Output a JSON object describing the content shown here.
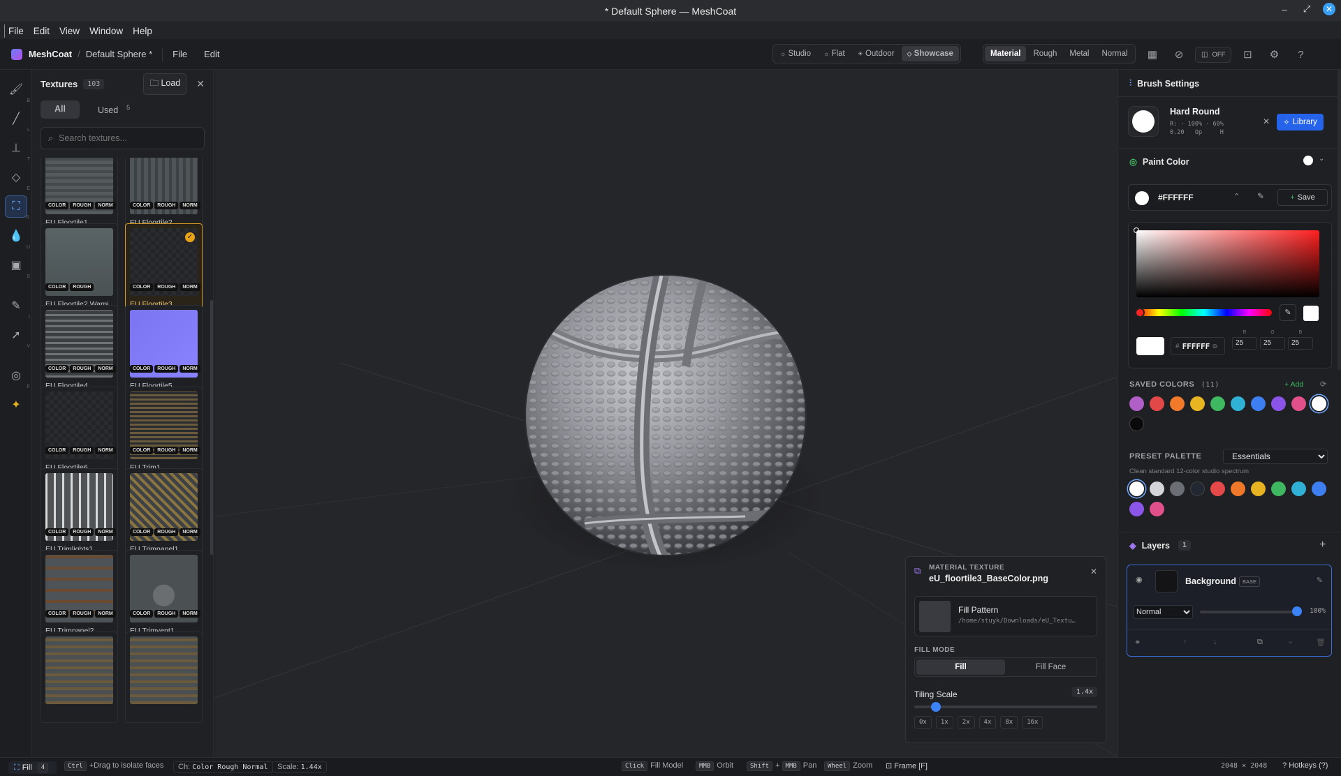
{
  "window": {
    "title": "* Default Sphere — MeshCoat"
  },
  "menubar": [
    "File",
    "Edit",
    "View",
    "Window",
    "Help"
  ],
  "appbar": {
    "app_name": "MeshCoat",
    "breadcrumb_sep": "/",
    "doc_name": "Default Sphere *",
    "menus": [
      "File",
      "Edit"
    ],
    "environments": [
      {
        "label": "Studio",
        "icon": "sun-icon"
      },
      {
        "label": "Flat",
        "icon": "dot-sun-icon"
      },
      {
        "label": "Outdoor",
        "icon": "sun-outline-icon"
      },
      {
        "label": "Showcase",
        "icon": "diamond-icon",
        "active": true
      }
    ],
    "channels": [
      {
        "label": "Material",
        "active": true
      },
      {
        "label": "Rough"
      },
      {
        "label": "Metal"
      },
      {
        "label": "Normal"
      }
    ],
    "symmetry_label": "OFF"
  },
  "tools": [
    {
      "name": "brush-tool",
      "key": "B"
    },
    {
      "name": "line-tool",
      "key": "L"
    },
    {
      "name": "stamp-tool",
      "key": "T"
    },
    {
      "name": "eraser-tool",
      "key": "E"
    },
    {
      "name": "fill-tool",
      "key": "G",
      "active": true
    },
    {
      "name": "smudge-tool",
      "key": "U"
    },
    {
      "name": "image-tool",
      "key": "S"
    },
    {
      "name": "eyedropper-tool",
      "key": "I"
    },
    {
      "name": "select-tool",
      "key": "V"
    },
    {
      "name": "frame-tool",
      "key": "F"
    },
    {
      "name": "ai-tool",
      "key": ""
    }
  ],
  "textures": {
    "title": "Textures",
    "count": "103",
    "load_label": "Load",
    "tabs": [
      {
        "label": "All",
        "active": true
      },
      {
        "label": "Used",
        "count": "5"
      }
    ],
    "search_placeholder": "Search textures...",
    "items": [
      {
        "label": "EU Floortile1",
        "chips": [
          "COLOR",
          "ROUGH",
          "NORM"
        ]
      },
      {
        "label": "EU Floortile2",
        "chips": [
          "COLOR",
          "ROUGH",
          "NORM"
        ]
      },
      {
        "label": "EU Floortile2 Warni...",
        "chips": [
          "COLOR",
          "ROUGH"
        ]
      },
      {
        "label": "EU Floortile3",
        "chips": [
          "COLOR",
          "ROUGH",
          "NORM"
        ],
        "selected": true
      },
      {
        "label": "EU Floortile4",
        "chips": [
          "COLOR",
          "ROUGH",
          "NORM"
        ]
      },
      {
        "label": "EU Floortile5",
        "chips": [
          "COLOR",
          "ROUGH",
          "NORM"
        ]
      },
      {
        "label": "EU Floortile6",
        "chips": [
          "COLOR",
          "ROUGH",
          "NORM"
        ]
      },
      {
        "label": "EU Trim1",
        "chips": [
          "COLOR",
          "ROUGH",
          "NORM"
        ]
      },
      {
        "label": "EU Trimlights1",
        "chips": [
          "COLOR",
          "ROUGH",
          "NORM"
        ]
      },
      {
        "label": "EU Trimpanel1",
        "chips": [
          "COLOR",
          "ROUGH",
          "NORM"
        ]
      },
      {
        "label": "EU Trimpanel2",
        "chips": [
          "COLOR",
          "ROUGH",
          "NORM"
        ]
      },
      {
        "label": "EU Trimvent1",
        "chips": [
          "COLOR",
          "ROUGH",
          "NORM"
        ]
      },
      {
        "label": "",
        "chips": []
      },
      {
        "label": "",
        "chips": []
      }
    ]
  },
  "material_panel": {
    "heading": "MATERIAL TEXTURE",
    "file": "eU_floortile3_BaseColor.png",
    "pattern_title": "Fill Pattern",
    "pattern_path": "/home/stuyk/Downloads/eU_Textu…",
    "fill_mode_label": "FILL MODE",
    "modes": [
      {
        "label": "Fill",
        "active": true
      },
      {
        "label": "Fill Face"
      }
    ],
    "tiling_label": "Tiling Scale",
    "tiling_value": "1.4x",
    "tiling_fraction": 0.09,
    "presets": [
      "0x",
      "1x",
      "2x",
      "4x",
      "8x",
      "16x"
    ]
  },
  "brush": {
    "title": "Brush Settings",
    "name": "Hard Round",
    "stats": [
      "R:",
      "100%",
      "60%",
      "0.20",
      "Op",
      "H"
    ],
    "library_label": "Library"
  },
  "paint": {
    "title": "Paint Color",
    "hex": "#FFFFFF",
    "save_label": "Save",
    "hex_input": "FFFFFF",
    "rgb_labels": [
      "R",
      "G",
      "B"
    ],
    "rgb_values": [
      "25",
      "25",
      "25"
    ]
  },
  "saved_colors": {
    "label": "SAVED COLORS",
    "count": "(11)",
    "add_label": "Add",
    "colors": [
      "#b05fc7",
      "#e34848",
      "#f07a2a",
      "#e9b422",
      "#3fb862",
      "#30b1d6",
      "#3d7ef0",
      "#8b54e8",
      "#e2508c",
      "#ffffff",
      "#0a0a0a"
    ],
    "selected_index": 9
  },
  "preset": {
    "label": "PRESET PALETTE",
    "selected": "Essentials",
    "options": [
      "Essentials"
    ],
    "description": "Clean standard 12-color studio spectrum",
    "colors": [
      "#ffffff",
      "#d4d5d8",
      "#6b6e75",
      "#222831",
      "#e54848",
      "#f0782a",
      "#e8b322",
      "#3eb760",
      "#30b0d4",
      "#3d7ef0",
      "#8b55e8",
      "#e2508c"
    ],
    "selected_index": 0
  },
  "layers": {
    "title": "Layers",
    "count": "1",
    "items": [
      {
        "name": "Background",
        "tag": "BASE",
        "blend": "Normal",
        "opacity": "100%",
        "opacity_fraction": 1.0
      }
    ],
    "blend_options": [
      "Normal"
    ]
  },
  "statusbar": {
    "tool": "Fill",
    "tool_key": "4",
    "hint_key": "Ctrl",
    "hint": "+Drag to isolate faces",
    "ch_label": "Ch:",
    "channels": "Color Rough Normal",
    "scale_label": "Scale:",
    "scale_value": "1.44x",
    "controls": [
      {
        "keys": [
          "Click"
        ],
        "action": "Fill Model"
      },
      {
        "keys": [
          "MMB"
        ],
        "action": "Orbit"
      },
      {
        "keys": [
          "Shift",
          "MMB"
        ],
        "action": "Pan"
      },
      {
        "keys": [
          "Wheel"
        ],
        "action": "Zoom"
      }
    ],
    "frame": "Frame [F]",
    "resolution": "2048 × 2048",
    "hotkeys": "Hotkeys (?)"
  },
  "colors": {
    "accent": "#3b82f6",
    "selected_card": "#d59b1e",
    "ai_tool": "#e9b422"
  }
}
